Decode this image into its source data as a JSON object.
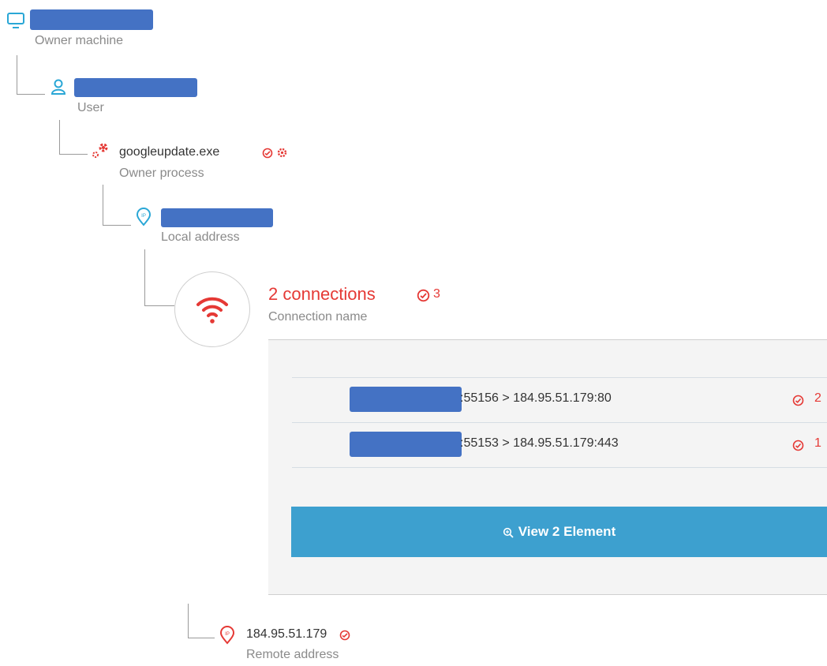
{
  "owner_machine": {
    "label": "Owner machine",
    "icon": "monitor-icon"
  },
  "user": {
    "label": "User",
    "icon": "user-icon"
  },
  "owner_process": {
    "name": "googleupdate.exe",
    "label": "Owner process",
    "icon": "gears-icon"
  },
  "local_address": {
    "label": "Local address",
    "icon": "ip-pin-icon"
  },
  "connection": {
    "title": "2 connections",
    "count": "3",
    "label": "Connection name",
    "icon": "wifi-icon"
  },
  "connections_list": [
    {
      "suffix": ":55156 > 184.95.51.179:80",
      "count": "2"
    },
    {
      "suffix": ":55153 > 184.95.51.179:443",
      "count": "1"
    }
  ],
  "view_button": {
    "label": "View 2 Element",
    "icon": "zoom-icon"
  },
  "remote_address": {
    "ip": "184.95.51.179",
    "label": "Remote address",
    "icon": "ip-pin-icon"
  },
  "colors": {
    "accent_blue": "#2aa7d6",
    "alert_red": "#e53935",
    "button": "#3da0cf",
    "redaction": "#4472c4"
  }
}
